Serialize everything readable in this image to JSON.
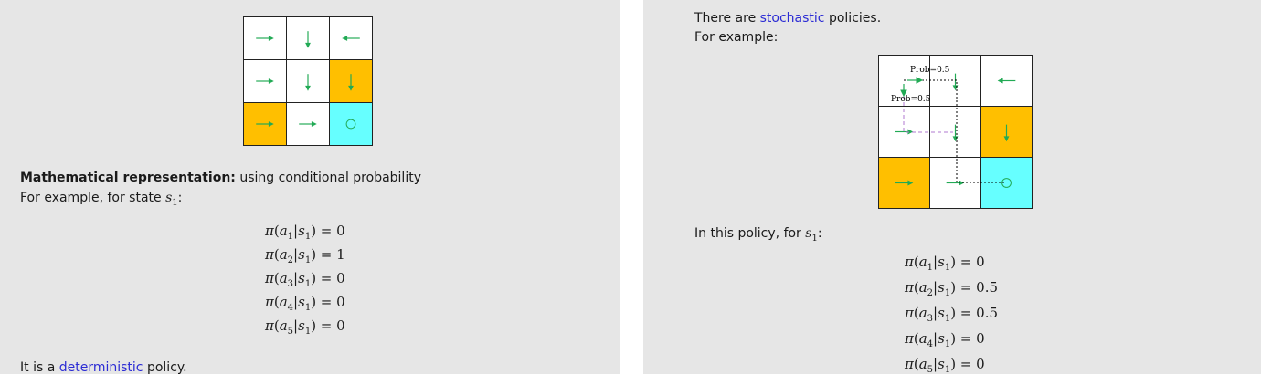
{
  "left": {
    "heading_bold": "Mathematical representation:",
    "heading_rest": " using conditional probability",
    "example_prefix": "For example, for state ",
    "state": "s",
    "state_sub": "1",
    "state_suffix": ":",
    "equations": [
      {
        "action_sub": "1",
        "value": "0"
      },
      {
        "action_sub": "2",
        "value": "1"
      },
      {
        "action_sub": "3",
        "value": "0"
      },
      {
        "action_sub": "4",
        "value": "0"
      },
      {
        "action_sub": "5",
        "value": "0"
      }
    ],
    "conclusion_prefix": "It is a ",
    "conclusion_term": "deterministic",
    "conclusion_suffix": " policy."
  },
  "right": {
    "intro_prefix": "There are ",
    "intro_term": "stochastic",
    "intro_suffix": " policies.",
    "example": "For example:",
    "prob_label_1": "Prob=0.5",
    "prob_label_2": "Prob=0.5",
    "policy_prefix": "In this policy, for ",
    "state": "s",
    "state_sub": "1",
    "policy_suffix": ":",
    "equations": [
      {
        "action_sub": "1",
        "value": "0"
      },
      {
        "action_sub": "2",
        "value": "0.5"
      },
      {
        "action_sub": "3",
        "value": "0.5"
      },
      {
        "action_sub": "4",
        "value": "0"
      },
      {
        "action_sub": "5",
        "value": "0"
      }
    ]
  },
  "grid_left_cells": [
    {
      "type": "normal",
      "icon": "arrow-right-icon"
    },
    {
      "type": "normal",
      "icon": "arrow-down-icon"
    },
    {
      "type": "normal",
      "icon": "arrow-left-icon"
    },
    {
      "type": "normal",
      "icon": "arrow-right-icon"
    },
    {
      "type": "normal",
      "icon": "arrow-down-icon"
    },
    {
      "type": "forbidden",
      "icon": "arrow-down-icon"
    },
    {
      "type": "forbidden",
      "icon": "arrow-right-icon"
    },
    {
      "type": "normal",
      "icon": "arrow-right-icon"
    },
    {
      "type": "target",
      "icon": "circle-icon"
    }
  ],
  "grid_right_cells": [
    {
      "type": "normal",
      "icon": "split-arrows-icon"
    },
    {
      "type": "normal",
      "icon": "arrow-down-icon"
    },
    {
      "type": "normal",
      "icon": "arrow-left-icon"
    },
    {
      "type": "normal",
      "icon": "arrow-right-icon"
    },
    {
      "type": "normal",
      "icon": "arrow-down-icon"
    },
    {
      "type": "forbidden",
      "icon": "arrow-down-icon"
    },
    {
      "type": "forbidden",
      "icon": "arrow-right-icon"
    },
    {
      "type": "normal",
      "icon": "arrow-right-icon"
    },
    {
      "type": "target",
      "icon": "circle-icon"
    }
  ],
  "colors": {
    "slide_bg": "#e6e6e6",
    "forbidden": "#ffbf00",
    "target": "#66ffff",
    "arrow": "#22aa55",
    "link_blue": "#2b2bd4",
    "path_dotted": "#000000",
    "path_dashed": "#b07ad0"
  }
}
